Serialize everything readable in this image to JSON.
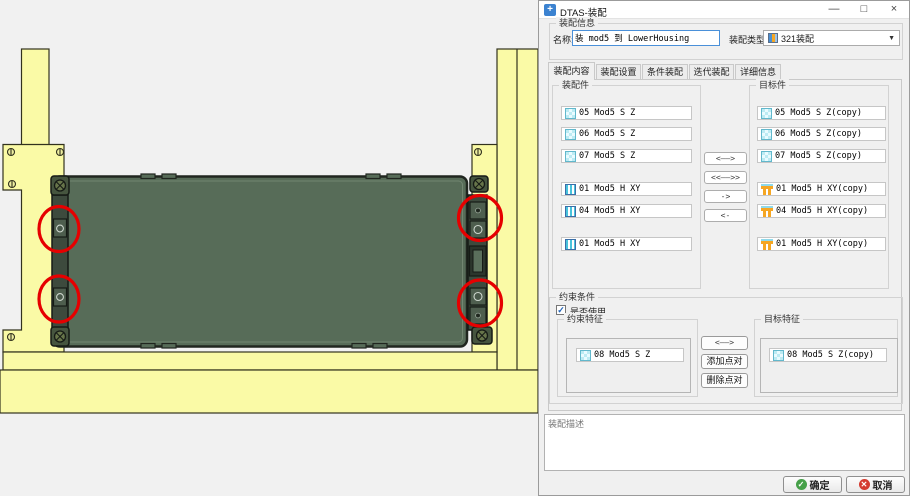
{
  "window": {
    "title": "DTAS-装配",
    "minimize": "—",
    "maximize": "□",
    "close": "×"
  },
  "info": {
    "group_title": "装配信息",
    "name_label": "名称:",
    "name_value": "装 mod5 到 LowerHousing",
    "type_label": "装配类型:",
    "type_value": "321装配"
  },
  "tabs": [
    "装配内容",
    "装配设置",
    "条件装配",
    "迭代装配",
    "详细信息"
  ],
  "content": {
    "assembly_group_title": "装配件",
    "target_group_title": "目标件",
    "assembly_items": [
      {
        "label": "05 Mod5 S Z"
      },
      {
        "label": "06 Mod5 S Z"
      },
      {
        "label": "07 Mod5 S Z"
      },
      {
        "label": "01 Mod5 H XY"
      },
      {
        "label": "04 Mod5 H XY"
      },
      {
        "label": "01 Mod5 H XY"
      }
    ],
    "target_items": [
      {
        "label": "05 Mod5 S Z(copy)"
      },
      {
        "label": "06 Mod5 S Z(copy)"
      },
      {
        "label": "07 Mod5 S Z(copy)"
      },
      {
        "label": "01 Mod5 H XY(copy)"
      },
      {
        "label": "04 Mod5 H XY(copy)"
      },
      {
        "label": "01 Mod5 H XY(copy)"
      }
    ],
    "transfer_buttons": [
      "<——>",
      "<<——>>",
      "->",
      "<-"
    ]
  },
  "constraints": {
    "group_title": "约束条件",
    "use_label": "是否使用",
    "checkbox_checked": true,
    "check_glyph": "✓",
    "constraint_group_title": "约束特征",
    "target_group_title": "目标特征",
    "constraint_item": "08 Mod5 S Z",
    "target_item": "08 Mod5 S Z(copy)",
    "swap_button": "<——>",
    "add_pair_button": "添加点对",
    "remove_pair_button": "删除点对"
  },
  "description_placeholder": "装配描述",
  "footer": {
    "ok_label": "确定",
    "cancel_label": "取消",
    "ok_icon_glyph": "✓",
    "cancel_icon_glyph": "✕"
  },
  "viewport": {
    "background": "#f1f1f1",
    "housing_color": "#fafaa6",
    "module_color": "#576c58",
    "annotation_color": "#e60000",
    "red_circle_count": 4
  }
}
